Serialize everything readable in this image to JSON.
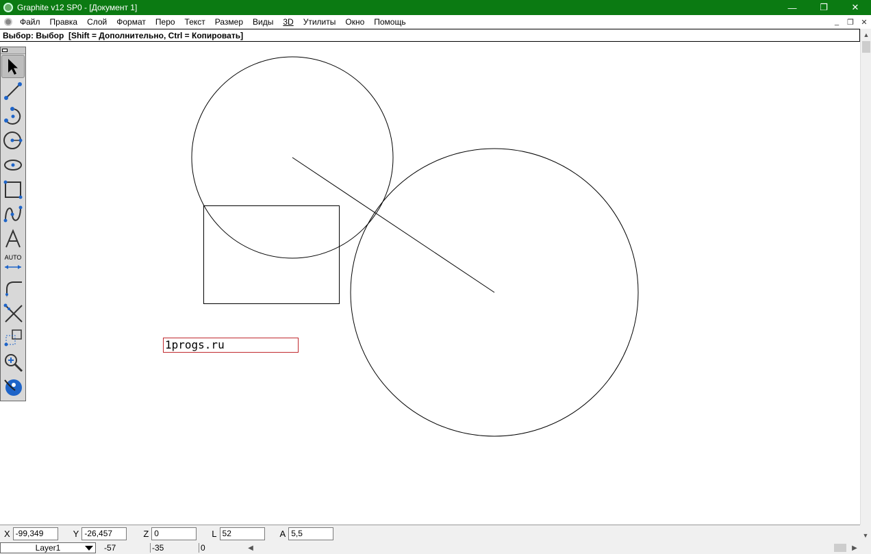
{
  "window": {
    "title": "Graphite v12 SP0 - [Документ 1]",
    "minimize": "—",
    "maximize": "❐",
    "close": "✕"
  },
  "menu": {
    "items": [
      "Файл",
      "Правка",
      "Слой",
      "Формат",
      "Перо",
      "Текст",
      "Размер",
      "Виды",
      "3D",
      "Утилиты",
      "Окно",
      "Помощь"
    ],
    "mdi_minimize": "_",
    "mdi_restore": "❐",
    "mdi_close": "✕"
  },
  "prompt": {
    "text": "Выбор: Выбор  [Shift = Дополнительно, Ctrl = Копировать]"
  },
  "toolbox": {
    "tools": [
      "select-tool",
      "line-tool",
      "arc-tool",
      "circle-tool",
      "ellipse-tool",
      "rectangle-tool",
      "spline-tool",
      "text-tool",
      "auto-dimension-tool",
      "fillet-tool",
      "trim-tool",
      "edit-tool",
      "zoom-tool",
      "view-tool"
    ],
    "auto_label": "AUTO"
  },
  "drawing": {
    "text_label": "1progs.ru",
    "text_box_color": "#c0282d"
  },
  "coords": {
    "x_label": "X",
    "x_value": "-99,349",
    "y_label": "Y",
    "y_value": "-26,457",
    "z_label": "Z",
    "z_value": "0",
    "l_label": "L",
    "l_value": "52",
    "a_label": "A",
    "a_value": "5,5"
  },
  "layerbar": {
    "layer": "Layer1",
    "v1": "-57",
    "v2": "-35",
    "v3": "0"
  },
  "colors": {
    "titlebar": "#0b7a12",
    "tool_blue": "#1e64c8"
  }
}
